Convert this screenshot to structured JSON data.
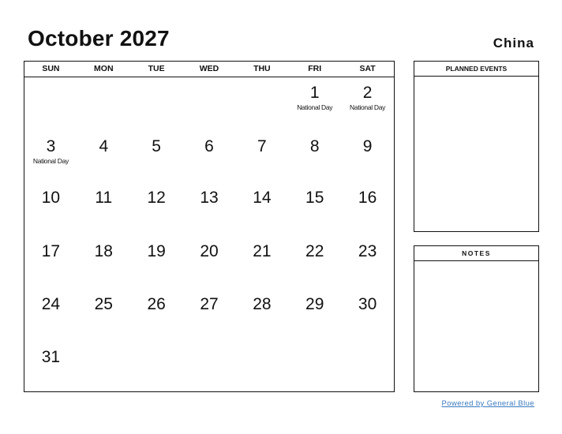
{
  "header": {
    "title": "October 2027",
    "country": "China"
  },
  "calendar": {
    "weekdays": [
      "SUN",
      "MON",
      "TUE",
      "WED",
      "THU",
      "FRI",
      "SAT"
    ],
    "weeks": [
      [
        {
          "day": ""
        },
        {
          "day": ""
        },
        {
          "day": ""
        },
        {
          "day": ""
        },
        {
          "day": ""
        },
        {
          "day": "1",
          "holiday": "National Day"
        },
        {
          "day": "2",
          "holiday": "National Day"
        }
      ],
      [
        {
          "day": "3",
          "holiday": "National Day"
        },
        {
          "day": "4"
        },
        {
          "day": "5"
        },
        {
          "day": "6"
        },
        {
          "day": "7"
        },
        {
          "day": "8"
        },
        {
          "day": "9"
        }
      ],
      [
        {
          "day": "10"
        },
        {
          "day": "11"
        },
        {
          "day": "12"
        },
        {
          "day": "13"
        },
        {
          "day": "14"
        },
        {
          "day": "15"
        },
        {
          "day": "16"
        }
      ],
      [
        {
          "day": "17"
        },
        {
          "day": "18"
        },
        {
          "day": "19"
        },
        {
          "day": "20"
        },
        {
          "day": "21"
        },
        {
          "day": "22"
        },
        {
          "day": "23"
        }
      ],
      [
        {
          "day": "24"
        },
        {
          "day": "25"
        },
        {
          "day": "26"
        },
        {
          "day": "27"
        },
        {
          "day": "28"
        },
        {
          "day": "29"
        },
        {
          "day": "30"
        }
      ],
      [
        {
          "day": "31"
        },
        {
          "day": ""
        },
        {
          "day": ""
        },
        {
          "day": ""
        },
        {
          "day": ""
        },
        {
          "day": ""
        },
        {
          "day": ""
        }
      ]
    ]
  },
  "panels": {
    "planned_events": "PLANNED EVENTS",
    "notes": "NOTES"
  },
  "footer": {
    "link_text": "Powered by General Blue",
    "link_color": "#3a7abf"
  }
}
